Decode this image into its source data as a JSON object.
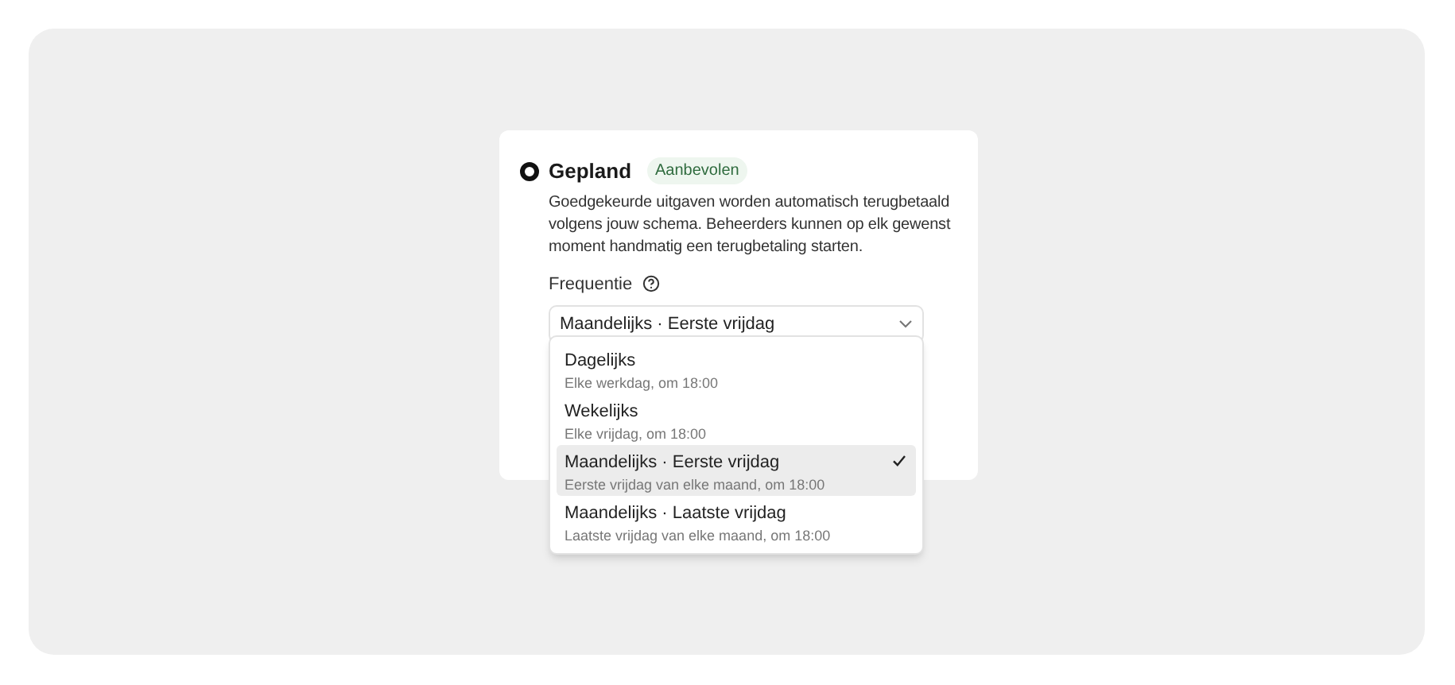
{
  "option": {
    "title": "Gepland",
    "selected": true,
    "badge": "Aanbevolen",
    "description": "Goedgekeurde uitgaven worden automatisch terugbetaald volgens jouw schema. Beheerders kunnen op elk gewenst moment handmatig een terugbetaling starten."
  },
  "frequency": {
    "label": "Frequentie",
    "value": "Maandelijks · Eerste vrijdag",
    "expanded": true,
    "options": [
      {
        "label": "Dagelijks",
        "description": "Elke werkdag, om 18:00",
        "selected": false
      },
      {
        "label": "Wekelijks",
        "description": "Elke vrijdag, om 18:00",
        "selected": false
      },
      {
        "label": "Maandelijks · Eerste vrijdag",
        "description": "Eerste vrijdag van elke maand, om 18:00",
        "selected": true
      },
      {
        "label": "Maandelijks · Laatste vrijdag",
        "description": "Laatste vrijdag van elke maand, om 18:00",
        "selected": false
      }
    ]
  }
}
